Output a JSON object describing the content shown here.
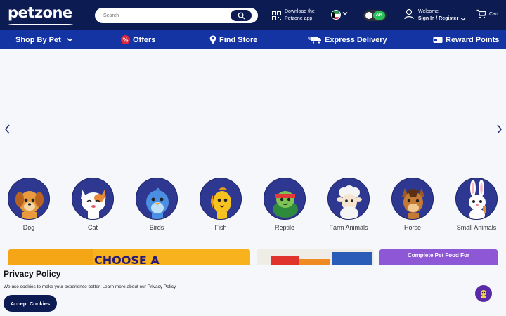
{
  "header": {
    "logo": "petzone",
    "search_placeholder": "Search",
    "app_download_line1": "Download the",
    "app_download_line2": "Petzone app",
    "language_toggle": "AR",
    "account_greeting": "Welcome",
    "account_action": "Sign In / Register",
    "cart_label": "Cart"
  },
  "nav": {
    "items": [
      {
        "label": "Shop By Pet",
        "icon": "chevron-down-icon"
      },
      {
        "label": "Offers",
        "icon": "percent-badge-icon"
      },
      {
        "label": "Find Store",
        "icon": "location-pin-icon"
      },
      {
        "label": "Express Delivery",
        "icon": "delivery-truck-icon"
      },
      {
        "label": "Reward Points",
        "icon": "reward-card-icon"
      }
    ]
  },
  "categories": [
    {
      "label": "Dog"
    },
    {
      "label": "Cat"
    },
    {
      "label": "Birds"
    },
    {
      "label": "Fish"
    },
    {
      "label": "Reptile"
    },
    {
      "label": "Farm Animals"
    },
    {
      "label": "Horse"
    },
    {
      "label": "Small Animals"
    }
  ],
  "banners": {
    "b1_text": "CHOOSE A",
    "b3_text": "Complete Pet Food For"
  },
  "privacy": {
    "title": "Privacy Policy",
    "text": "We use cookies to make your experience better.",
    "link": "Learn more about our Privacy Policy",
    "accept_label": "Accept Cookies"
  },
  "colors": {
    "topbar": "#0c1b52",
    "navbar": "#1434a4",
    "accent_green": "#27c35a",
    "category_circle": "#2f3891"
  }
}
